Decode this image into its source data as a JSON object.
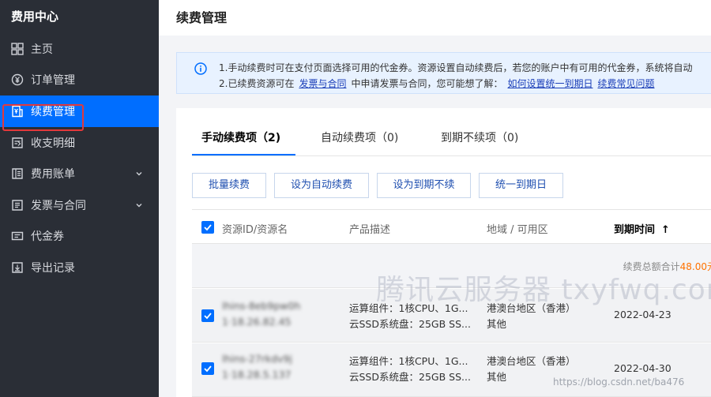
{
  "sidebar": {
    "app_title": "费用中心",
    "items": [
      {
        "label": "主页",
        "icon": "grid-icon"
      },
      {
        "label": "订单管理",
        "icon": "yen-circle-icon"
      },
      {
        "label": "续费管理",
        "icon": "renew-doc-icon",
        "active": true
      },
      {
        "label": "收支明细",
        "icon": "list-arrow-icon"
      },
      {
        "label": "费用账单",
        "icon": "bill-icon",
        "expandable": true
      },
      {
        "label": "发票与合同",
        "icon": "invoice-icon",
        "expandable": true
      },
      {
        "label": "代金券",
        "icon": "voucher-icon"
      },
      {
        "label": "导出记录",
        "icon": "export-icon"
      }
    ]
  },
  "header": {
    "title": "续费管理"
  },
  "notice": {
    "line1": "1.手动续费时可在支付页面选择可用的代金券。资源设置自动续费后，若您的账户中有可用的代金券，系统将自动",
    "line2_prefix": "2.已续费资源可在",
    "line2_link1": "发票与合同",
    "line2_middle": "中申请发票与合同，您可能想了解：",
    "line2_link2": "如何设置统一到期日",
    "line2_link3": "续费常见问题"
  },
  "tabs": [
    {
      "label": "手动续费项（2)",
      "active": true
    },
    {
      "label": "自动续费项（0)"
    },
    {
      "label": "到期不续项（0)"
    }
  ],
  "toolbar": {
    "batch_renew": "批量续费",
    "set_auto": "设为自动续费",
    "set_no_renew": "设为到期不续",
    "unify_date": "统一到期日"
  },
  "table": {
    "columns": {
      "resource": "资源ID/资源名",
      "product": "产品描述",
      "region": "地域 / 可用区",
      "expire": "到期时间",
      "sort_arrow": "↑"
    },
    "summary_label": "续费总额合计",
    "summary_amount": "48.00元",
    "rows": [
      {
        "id": "lhins-8eb9pw0h",
        "name": "1·18.26.82.45",
        "product_line1": "运算组件：1核CPU、1G...",
        "product_line2": "云SSD系统盘：25GB SS...",
        "region_line1": "港澳台地区（香港）",
        "region_line2": "其他",
        "expire": "2022-04-23"
      },
      {
        "id": "lhins-27rkdv9j",
        "name": "1·18.28.5.137",
        "product_line1": "运算组件：1核CPU、1G...",
        "product_line2": "云SSD系统盘：25GB SS...",
        "region_line1": "港澳台地区（香港）",
        "region_line2": "其他",
        "expire": "2022-04-30"
      }
    ]
  },
  "watermark": "腾讯云服务器 txyfwq.com",
  "source_mark": "https://blog.csdn.net/ba476",
  "colors": {
    "accent": "#006eff",
    "sidebar_bg": "#2a2e36",
    "highlight": "#ff7200",
    "outline": "#e3393c"
  }
}
